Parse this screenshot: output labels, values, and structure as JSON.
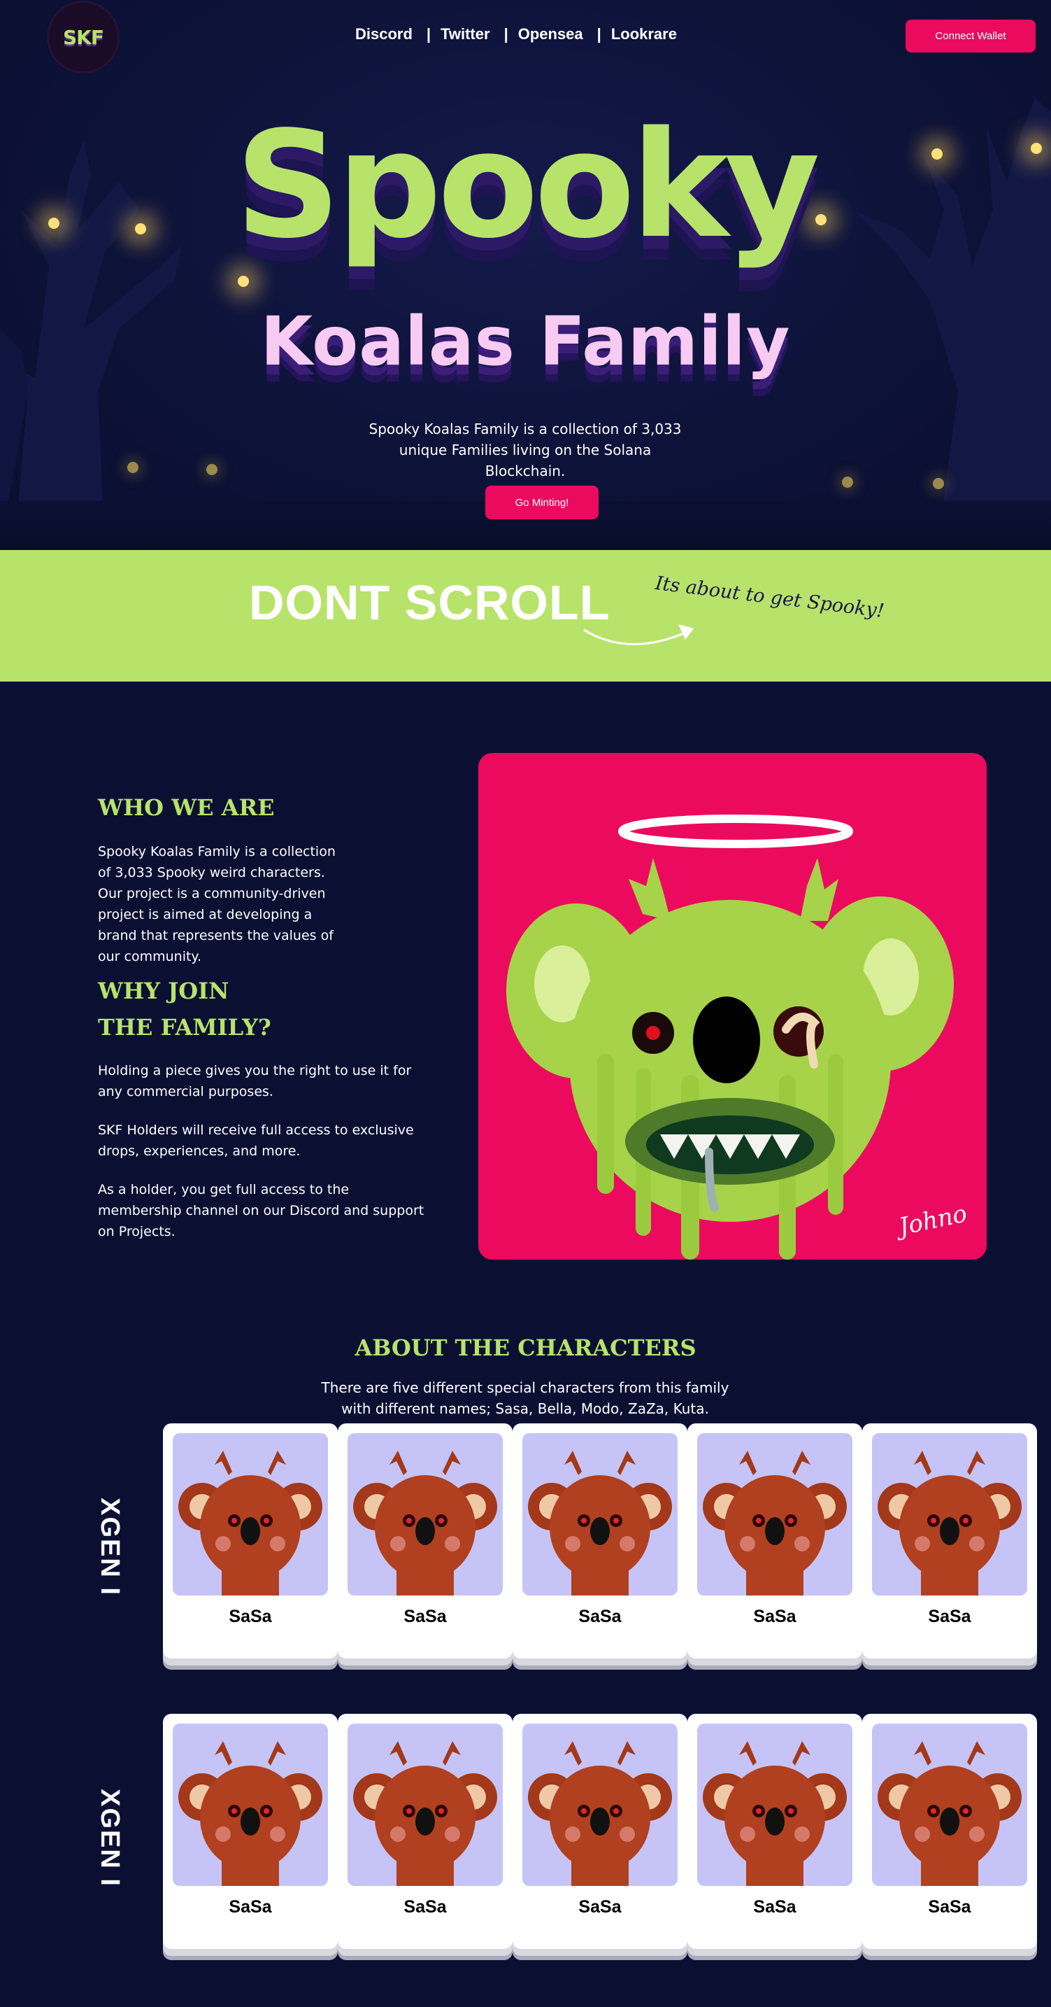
{
  "header": {
    "logo_text": "SKF",
    "nav": [
      "Discord",
      "Twitter",
      "Opensea",
      "Lookrare"
    ],
    "connect_label": "Connect Wallet"
  },
  "hero": {
    "title": "Spooky",
    "subtitle": "Koalas Family",
    "description": "Spooky Koalas Family is a collection of 3,033 unique Families living on the Solana Blockchain.",
    "cta_label": "Go Minting!"
  },
  "band": {
    "main": "DONT SCROLL",
    "script": "Its about to get Spooky!"
  },
  "about": {
    "who_title": "WHO WE ARE",
    "who_text": "Spooky Koalas Family is a collection of 3,033 Spooky weird characters. Our project is a community-driven project is aimed at developing a brand that represents the values of our community.",
    "why_title": "WHY JOIN THE FAMILY?",
    "why_points": [
      "Holding a piece gives you the right to use it for any commercial purposes.",
      "SKF Holders will receive full access to exclusive drops, experiences, and more.",
      "As a holder, you get full access to the membership channel on our Discord and support on Projects."
    ],
    "signature": "Johno"
  },
  "characters": {
    "title": "ABOUT THE CHARACTERS",
    "description": "There are five different special characters from this family with different names; Sasa, Bella, Modo, ZaZa, Kuta.",
    "rows": [
      {
        "label": "XGEN I",
        "cards": [
          "SaSa",
          "SaSa",
          "SaSa",
          "SaSa",
          "SaSa"
        ]
      },
      {
        "label": "XGEN I",
        "cards": [
          "SaSa",
          "SaSa",
          "SaSa",
          "SaSa",
          "SaSa"
        ]
      }
    ]
  },
  "colors": {
    "background": "#0b1033",
    "accent_green": "#b8e36b",
    "accent_pink": "#ea0b5e",
    "title_pink": "#f7cbf2",
    "card_lavender": "#c6c4f6"
  }
}
